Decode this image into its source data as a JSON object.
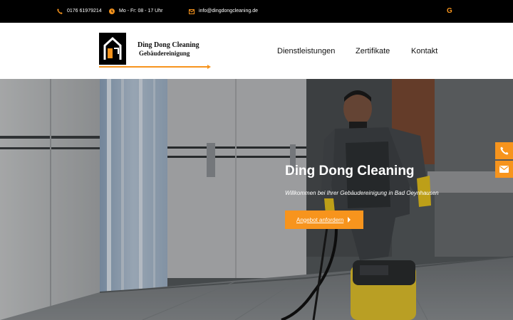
{
  "topbar": {
    "phone": "0176 61979214",
    "hours": "Mo - Fr: 08 - 17 Uhr",
    "email": "info@dingdongcleaning.de",
    "google_glyph": "G"
  },
  "logo": {
    "line1": "Ding Dong Cleaning",
    "line2": "Gebäudereinigung"
  },
  "nav": {
    "items": [
      "Dienstleistungen",
      "Zertifikate",
      "Kontakt"
    ]
  },
  "hero": {
    "title": "Ding Dong Cleaning",
    "subtitle": "Willkommen bei Ihrer Gebäudereinigung in Bad Oeynhausen",
    "button_label": "Angebot anfordern"
  },
  "icons": {
    "topbar": [
      "phone-icon",
      "clock-icon",
      "mail-icon",
      "google-icon"
    ],
    "side": [
      "phone-icon",
      "mail-icon"
    ]
  },
  "colors": {
    "accent": "#f7941d",
    "topbar_bg": "#000000"
  }
}
